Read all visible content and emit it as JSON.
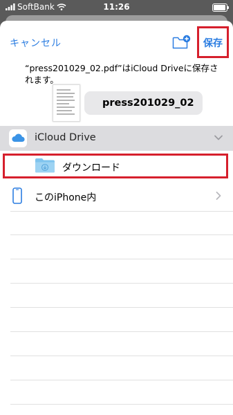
{
  "status_bar": {
    "carrier": "SoftBank",
    "time": "11:26"
  },
  "nav": {
    "cancel_label": "キャンセル",
    "save_label": "保存"
  },
  "message": {
    "text": "“press201029_02.pdf”はiCloud Driveに保存されます。"
  },
  "file": {
    "name": "press201029_02"
  },
  "locations": {
    "icloud_label": "iCloud Drive",
    "downloads_label": "ダウンロード",
    "iphone_label": "このiPhone内"
  },
  "colors": {
    "accent": "#2b7de1",
    "highlight": "#d61f2c",
    "folder": "#7fc4ee"
  }
}
